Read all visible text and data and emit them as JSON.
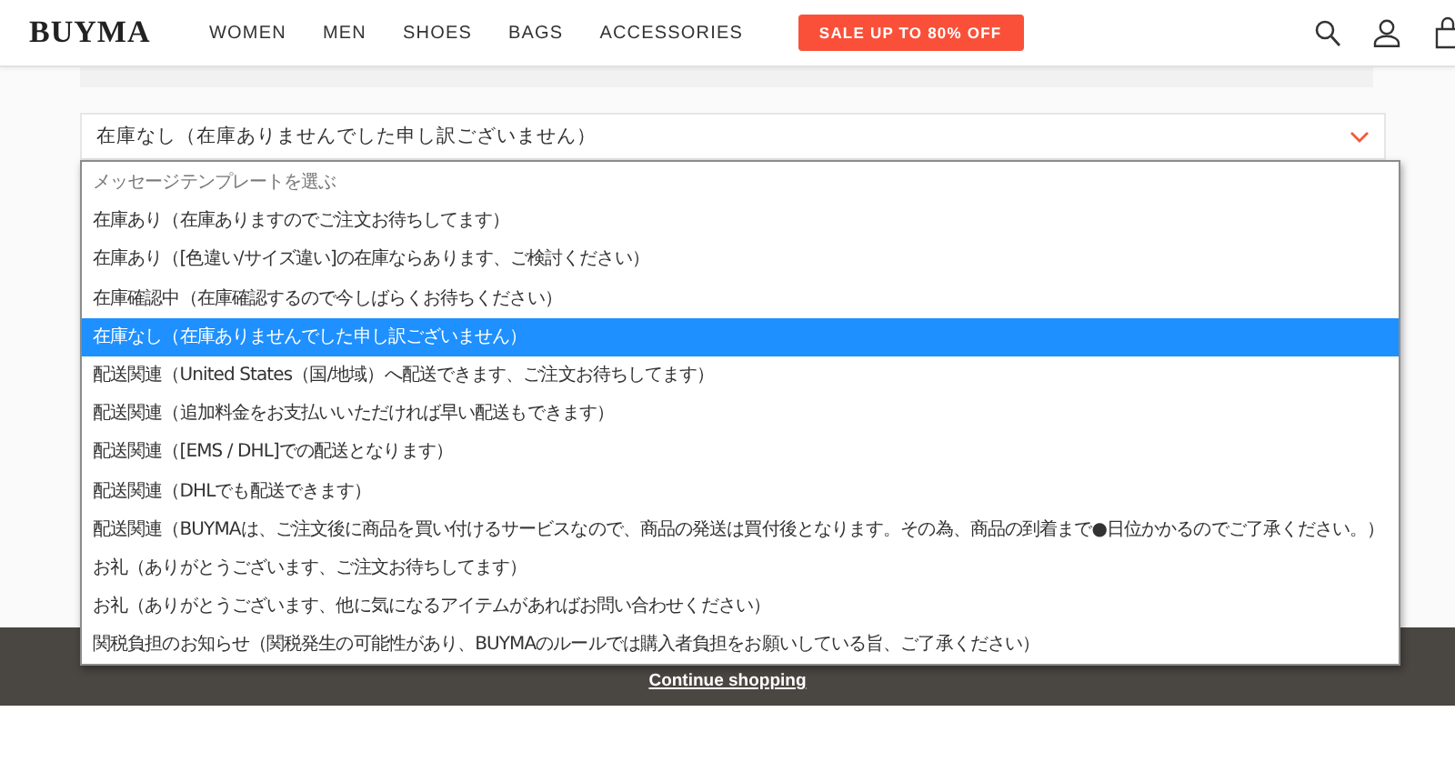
{
  "header": {
    "logo": "BUYMA",
    "nav": [
      "WOMEN",
      "MEN",
      "SHOES",
      "BAGS",
      "ACCESSORIES"
    ],
    "sale_button": "SALE UP TO 80% OFF"
  },
  "template_select": {
    "value": "在庫なし（在庫ありませんでした申し訳ございません）",
    "expanded": true,
    "options": [
      {
        "label": "メッセージテンプレートを選ぶ",
        "kind": "placeholder",
        "selected": false
      },
      {
        "label": "在庫あり（在庫ありますのでご注文お待ちしてます）",
        "kind": "option",
        "selected": false
      },
      {
        "label": "在庫あり（[色違い/サイズ違い]の在庫ならあります、ご検討ください）",
        "kind": "option",
        "selected": false
      },
      {
        "label": "在庫確認中（在庫確認するので今しばらくお待ちください）",
        "kind": "option",
        "selected": false
      },
      {
        "label": "在庫なし（在庫ありませんでした申し訳ございません）",
        "kind": "option",
        "selected": true
      },
      {
        "label": "配送関連（United States（国/地域）へ配送できます、ご注文お待ちしてます）",
        "kind": "option",
        "selected": false
      },
      {
        "label": "配送関連（追加料金をお支払いいただければ早い配送もできます）",
        "kind": "option",
        "selected": false
      },
      {
        "label": "配送関連（[EMS / DHL]での配送となります）",
        "kind": "option",
        "selected": false
      },
      {
        "label": "配送関連（DHLでも配送できます）",
        "kind": "option",
        "selected": false
      },
      {
        "label": "配送関連（BUYMAは、ご注文後に商品を買い付けるサービスなので、商品の発送は買付後となります。その為、商品の到着まで●日位かかるのでご了承ください。）",
        "kind": "option",
        "selected": false
      },
      {
        "label": "お礼（ありがとうございます、ご注文お待ちしてます）",
        "kind": "option",
        "selected": false
      },
      {
        "label": "お礼（ありがとうございます、他に気になるアイテムがあればお問い合わせください）",
        "kind": "option",
        "selected": false
      },
      {
        "label": "関税負担のお知らせ（関税発生の可能性があり、BUYMAのルールでは購入者負担をお願いしている旨、ご了承ください）",
        "kind": "option",
        "selected": false
      }
    ]
  },
  "footer": {
    "link": "Continue shopping"
  }
}
